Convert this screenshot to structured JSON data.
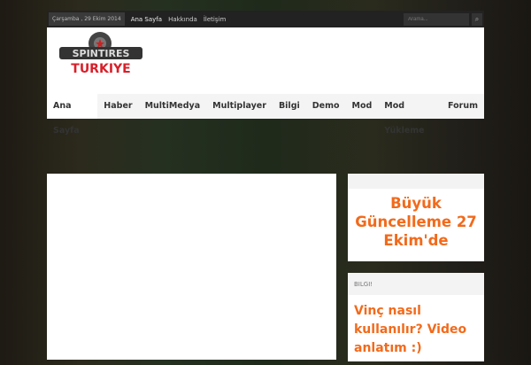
{
  "topbar": {
    "date": "Çarşamba , 29 Ekim 2014",
    "links": [
      "Ana Sayfa",
      "Hakkında",
      "İletişim"
    ],
    "search_placeholder": "Arama..."
  },
  "logo": {
    "line1": "SPINTIRES",
    "line2": "TURKIYE"
  },
  "nav": [
    "Ana Sayfa",
    "Haber",
    "MultiMedya",
    "Multiplayer",
    "Bilgi",
    "Demo",
    "Mod",
    "Mod Yükleme",
    "Forum"
  ],
  "sidebar": {
    "widget1": {
      "title": "Büyük Güncelleme 27 Ekim'de"
    },
    "widget2": {
      "header": "BILGI!",
      "post": "Vinç nasıl kullanılır? Video anlatım :)"
    }
  },
  "colors": {
    "accent": "#f26a1b"
  }
}
